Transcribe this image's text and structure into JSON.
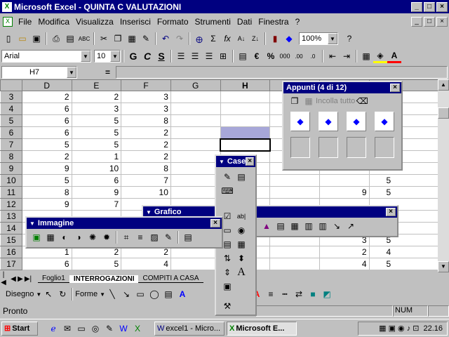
{
  "window": {
    "title": "Microsoft Excel - QUINTA C VALUTAZIONI",
    "controls": [
      "_",
      "□",
      "×"
    ]
  },
  "menu": [
    "File",
    "Modifica",
    "Visualizza",
    "Inserisci",
    "Formato",
    "Strumenti",
    "Dati",
    "Finestra",
    "?"
  ],
  "standard_toolbar": {
    "zoom": "100%",
    "icons": [
      "new-icon",
      "open-icon",
      "save-icon",
      "print-icon",
      "print-preview-icon",
      "spelling-icon",
      "cut-icon",
      "copy-icon",
      "paste-icon",
      "format-painter-icon",
      "undo-icon",
      "redo-icon",
      "hyperlink-icon",
      "autosum-icon",
      "function-icon",
      "sort-asc-icon",
      "sort-desc-icon",
      "chart-wizard-icon",
      "drawing-icon",
      "help-icon"
    ]
  },
  "format_toolbar": {
    "font": "Arial",
    "size": "10",
    "bold": "G",
    "italic": "C",
    "underline": "S",
    "euro": "€",
    "percent": "%",
    "thousands": "000"
  },
  "formula_bar": {
    "name_box": "H7",
    "equals": "="
  },
  "grid": {
    "columns": [
      "D",
      "E",
      "F",
      "G",
      "H",
      "I"
    ],
    "rows": [
      {
        "n": "3",
        "d": "2",
        "e": "2",
        "f": "3"
      },
      {
        "n": "4",
        "d": "6",
        "e": "3",
        "f": "3"
      },
      {
        "n": "5",
        "d": "6",
        "e": "5",
        "f": "8"
      },
      {
        "n": "6",
        "d": "6",
        "e": "5",
        "f": "2"
      },
      {
        "n": "7",
        "d": "5",
        "e": "5",
        "f": "2"
      },
      {
        "n": "8",
        "d": "2",
        "e": "1",
        "f": "2"
      },
      {
        "n": "9",
        "d": "9",
        "e": "10",
        "f": "8"
      },
      {
        "n": "10",
        "d": "5",
        "e": "6",
        "f": "7"
      },
      {
        "n": "11",
        "d": "8",
        "e": "9",
        "f": "10"
      },
      {
        "n": "12",
        "d": "9",
        "e": "7",
        "f": ""
      },
      {
        "n": "13",
        "d": "",
        "e": "",
        "f": ""
      },
      {
        "n": "14",
        "d": "",
        "e": "",
        "f": ""
      },
      {
        "n": "15",
        "d": "",
        "e": "",
        "f": ""
      },
      {
        "n": "16",
        "d": "1",
        "e": "2",
        "f": "2"
      },
      {
        "n": "17",
        "d": "6",
        "e": "5",
        "f": "4"
      }
    ],
    "right_cols": [
      {
        "row": "10",
        "a": "",
        "b": "5"
      },
      {
        "row": "11",
        "a": "9",
        "b": "5"
      },
      {
        "row": "15",
        "a": "3",
        "b": "5"
      },
      {
        "row": "16",
        "a": "2",
        "b": "4"
      },
      {
        "row": "17",
        "a": "4",
        "b": "5"
      }
    ]
  },
  "sheet_tabs": [
    "Foglio1",
    "INTERROGAZIONI",
    "COMPITI A CASA"
  ],
  "drawing_toolbar": {
    "draw": "Disegno",
    "shapes": "Forme"
  },
  "status": {
    "text": "Pronto",
    "num": "NUM"
  },
  "taskbar": {
    "start": "Start",
    "tasks": [
      "excel1 - Micro...",
      "Microsoft E..."
    ],
    "clock": "22.16"
  },
  "palettes": {
    "clipboard": {
      "title": "Appunti (4 di 12)",
      "paste_all": "Incolla tutto"
    },
    "controls": {
      "title": "Case"
    },
    "chart": {
      "title": "Grafico"
    },
    "picture": {
      "title": "Immagine"
    }
  }
}
